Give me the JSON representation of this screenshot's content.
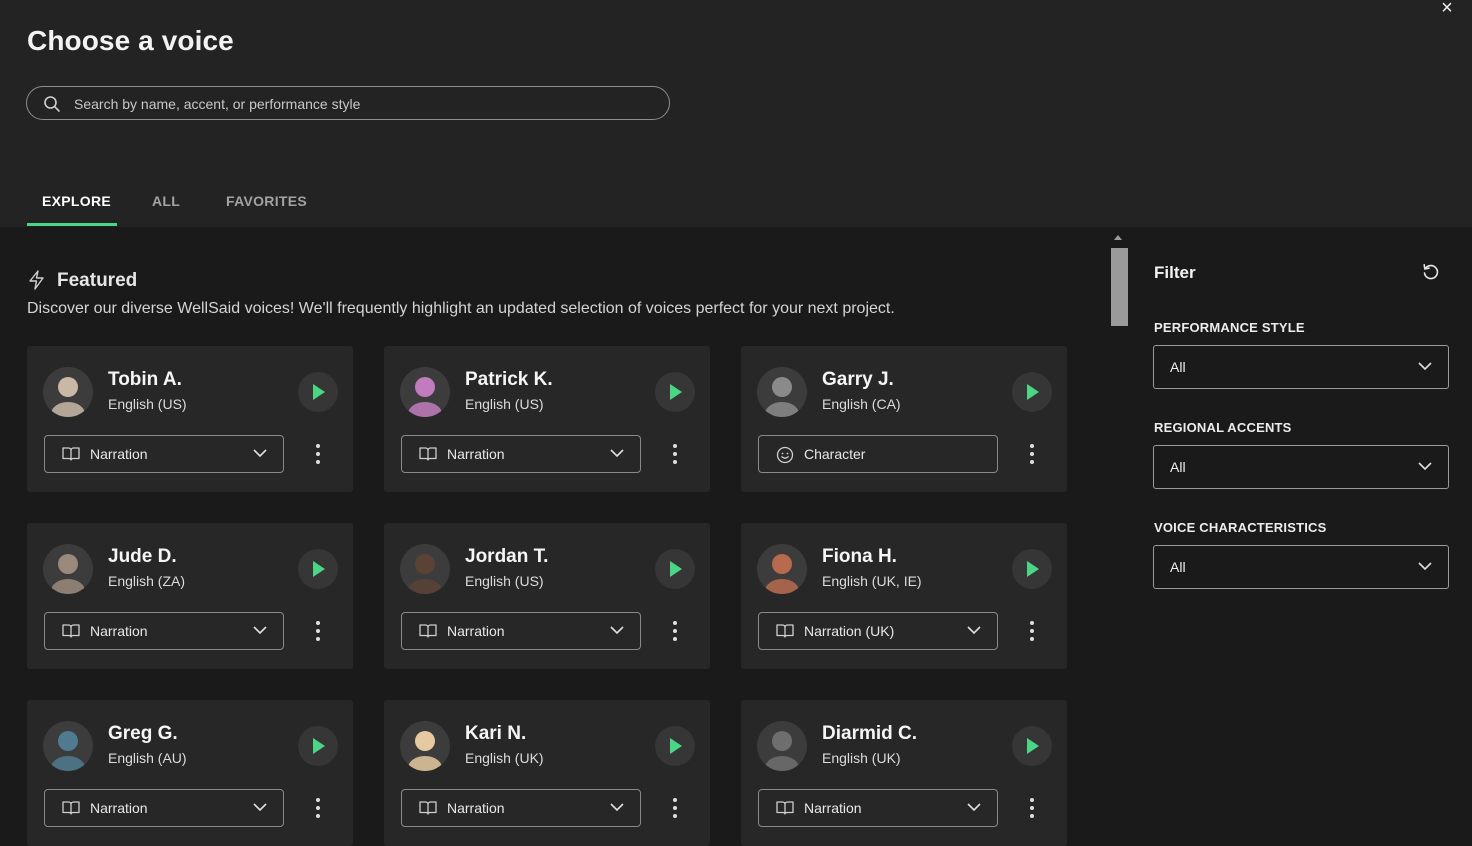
{
  "dialog": {
    "title": "Choose a voice",
    "close_label": "×"
  },
  "search": {
    "placeholder": "Search by name, accent, or performance style",
    "value": ""
  },
  "tabs": [
    {
      "label": "EXPLORE",
      "active": true
    },
    {
      "label": "ALL",
      "active": false
    },
    {
      "label": "FAVORITES",
      "active": false
    }
  ],
  "featured": {
    "title": "Featured",
    "description": "Discover our diverse WellSaid voices! We'll frequently highlight an updated selection of voices perfect for your next project."
  },
  "voices": [
    {
      "name": "Tobin A.",
      "accent": "English (US)",
      "style": "Narration",
      "style_icon": "book-icon",
      "has_dropdown": true,
      "avatar_color": "#c9b8a6"
    },
    {
      "name": "Patrick K.",
      "accent": "English (US)",
      "style": "Narration",
      "style_icon": "book-icon",
      "has_dropdown": true,
      "avatar_color": "#c27bbd"
    },
    {
      "name": "Garry J.",
      "accent": "English (CA)",
      "style": "Character",
      "style_icon": "smiley-icon",
      "has_dropdown": false,
      "avatar_color": "#8a8a8a"
    },
    {
      "name": "Jude D.",
      "accent": "English (ZA)",
      "style": "Narration",
      "style_icon": "book-icon",
      "has_dropdown": true,
      "avatar_color": "#9b8a7c"
    },
    {
      "name": "Jordan T.",
      "accent": "English (US)",
      "style": "Narration",
      "style_icon": "book-icon",
      "has_dropdown": true,
      "avatar_color": "#5a4235"
    },
    {
      "name": "Fiona H.",
      "accent": "English (UK, IE)",
      "style": "Narration (UK)",
      "style_icon": "book-icon",
      "has_dropdown": true,
      "avatar_color": "#b86a4f"
    },
    {
      "name": "Greg G.",
      "accent": "English (AU)",
      "style": "Narration",
      "style_icon": "book-icon",
      "has_dropdown": true,
      "avatar_color": "#4f7a8f"
    },
    {
      "name": "Kari N.",
      "accent": "English (UK)",
      "style": "Narration",
      "style_icon": "book-icon",
      "has_dropdown": true,
      "avatar_color": "#e5c9a0"
    },
    {
      "name": "Diarmid C.",
      "accent": "English (UK)",
      "style": "Narration",
      "style_icon": "book-icon",
      "has_dropdown": true,
      "avatar_color": "#6e6e6e"
    }
  ],
  "filter": {
    "title": "Filter",
    "groups": [
      {
        "label": "PERFORMANCE STYLE",
        "value": "All"
      },
      {
        "label": "REGIONAL ACCENTS",
        "value": "All"
      },
      {
        "label": "VOICE CHARACTERISTICS",
        "value": "All"
      }
    ]
  },
  "colors": {
    "accent_green": "#4bd685",
    "card_bg": "#272727",
    "page_bg": "#1a1a1a",
    "header_bg": "#232323"
  }
}
